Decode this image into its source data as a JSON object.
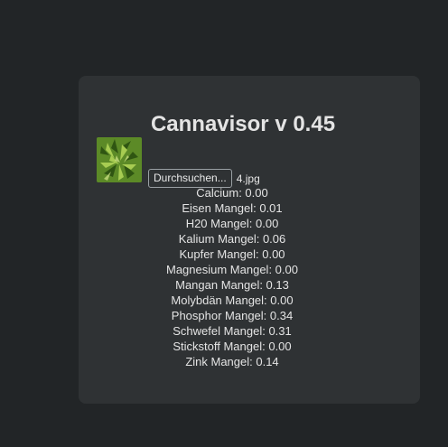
{
  "app": {
    "title": "Cannavisor v 0.45"
  },
  "upload": {
    "button_label": "Durchsuchen...",
    "file_name": "4.jpg",
    "thumbnail_icon": "cannabis-leaf-image"
  },
  "results": [
    {
      "label": "Calcium: 0.00"
    },
    {
      "label": "Eisen Mangel: 0.01"
    },
    {
      "label": "H20 Mangel: 0.00"
    },
    {
      "label": "Kalium Mangel: 0.06"
    },
    {
      "label": "Kupfer Mangel: 0.00"
    },
    {
      "label": "Magnesium Mangel: 0.00"
    },
    {
      "label": "Mangan Mangel: 0.13"
    },
    {
      "label": "Molybdän Mangel: 0.00"
    },
    {
      "label": "Phosphor Mangel: 0.34"
    },
    {
      "label": "Schwefel Mangel: 0.31"
    },
    {
      "label": "Stickstoff Mangel: 0.00"
    },
    {
      "label": "Zink Mangel: 0.14"
    }
  ],
  "colors": {
    "page_background": "#222527",
    "card_background": "#2f3234",
    "text": "#e4e4e4"
  }
}
